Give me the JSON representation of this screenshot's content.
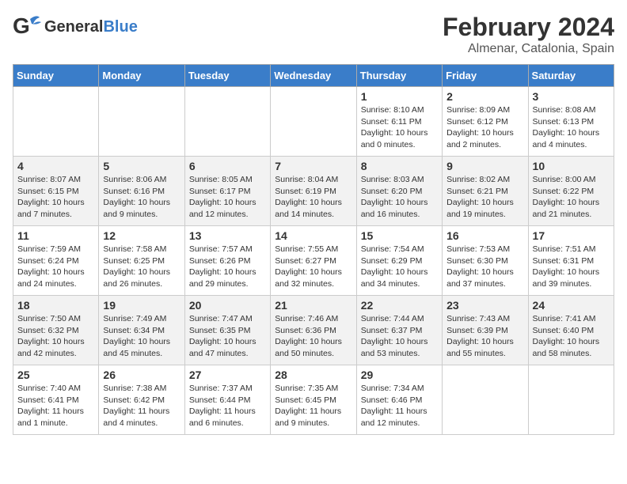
{
  "header": {
    "logo_general": "General",
    "logo_blue": "Blue",
    "title": "February 2024",
    "subtitle": "Almenar, Catalonia, Spain"
  },
  "weekdays": [
    "Sunday",
    "Monday",
    "Tuesday",
    "Wednesday",
    "Thursday",
    "Friday",
    "Saturday"
  ],
  "weeks": [
    [
      {
        "day": "",
        "info": ""
      },
      {
        "day": "",
        "info": ""
      },
      {
        "day": "",
        "info": ""
      },
      {
        "day": "",
        "info": ""
      },
      {
        "day": "1",
        "info": "Sunrise: 8:10 AM\nSunset: 6:11 PM\nDaylight: 10 hours and 0 minutes."
      },
      {
        "day": "2",
        "info": "Sunrise: 8:09 AM\nSunset: 6:12 PM\nDaylight: 10 hours and 2 minutes."
      },
      {
        "day": "3",
        "info": "Sunrise: 8:08 AM\nSunset: 6:13 PM\nDaylight: 10 hours and 4 minutes."
      }
    ],
    [
      {
        "day": "4",
        "info": "Sunrise: 8:07 AM\nSunset: 6:15 PM\nDaylight: 10 hours and 7 minutes."
      },
      {
        "day": "5",
        "info": "Sunrise: 8:06 AM\nSunset: 6:16 PM\nDaylight: 10 hours and 9 minutes."
      },
      {
        "day": "6",
        "info": "Sunrise: 8:05 AM\nSunset: 6:17 PM\nDaylight: 10 hours and 12 minutes."
      },
      {
        "day": "7",
        "info": "Sunrise: 8:04 AM\nSunset: 6:19 PM\nDaylight: 10 hours and 14 minutes."
      },
      {
        "day": "8",
        "info": "Sunrise: 8:03 AM\nSunset: 6:20 PM\nDaylight: 10 hours and 16 minutes."
      },
      {
        "day": "9",
        "info": "Sunrise: 8:02 AM\nSunset: 6:21 PM\nDaylight: 10 hours and 19 minutes."
      },
      {
        "day": "10",
        "info": "Sunrise: 8:00 AM\nSunset: 6:22 PM\nDaylight: 10 hours and 21 minutes."
      }
    ],
    [
      {
        "day": "11",
        "info": "Sunrise: 7:59 AM\nSunset: 6:24 PM\nDaylight: 10 hours and 24 minutes."
      },
      {
        "day": "12",
        "info": "Sunrise: 7:58 AM\nSunset: 6:25 PM\nDaylight: 10 hours and 26 minutes."
      },
      {
        "day": "13",
        "info": "Sunrise: 7:57 AM\nSunset: 6:26 PM\nDaylight: 10 hours and 29 minutes."
      },
      {
        "day": "14",
        "info": "Sunrise: 7:55 AM\nSunset: 6:27 PM\nDaylight: 10 hours and 32 minutes."
      },
      {
        "day": "15",
        "info": "Sunrise: 7:54 AM\nSunset: 6:29 PM\nDaylight: 10 hours and 34 minutes."
      },
      {
        "day": "16",
        "info": "Sunrise: 7:53 AM\nSunset: 6:30 PM\nDaylight: 10 hours and 37 minutes."
      },
      {
        "day": "17",
        "info": "Sunrise: 7:51 AM\nSunset: 6:31 PM\nDaylight: 10 hours and 39 minutes."
      }
    ],
    [
      {
        "day": "18",
        "info": "Sunrise: 7:50 AM\nSunset: 6:32 PM\nDaylight: 10 hours and 42 minutes."
      },
      {
        "day": "19",
        "info": "Sunrise: 7:49 AM\nSunset: 6:34 PM\nDaylight: 10 hours and 45 minutes."
      },
      {
        "day": "20",
        "info": "Sunrise: 7:47 AM\nSunset: 6:35 PM\nDaylight: 10 hours and 47 minutes."
      },
      {
        "day": "21",
        "info": "Sunrise: 7:46 AM\nSunset: 6:36 PM\nDaylight: 10 hours and 50 minutes."
      },
      {
        "day": "22",
        "info": "Sunrise: 7:44 AM\nSunset: 6:37 PM\nDaylight: 10 hours and 53 minutes."
      },
      {
        "day": "23",
        "info": "Sunrise: 7:43 AM\nSunset: 6:39 PM\nDaylight: 10 hours and 55 minutes."
      },
      {
        "day": "24",
        "info": "Sunrise: 7:41 AM\nSunset: 6:40 PM\nDaylight: 10 hours and 58 minutes."
      }
    ],
    [
      {
        "day": "25",
        "info": "Sunrise: 7:40 AM\nSunset: 6:41 PM\nDaylight: 11 hours and 1 minute."
      },
      {
        "day": "26",
        "info": "Sunrise: 7:38 AM\nSunset: 6:42 PM\nDaylight: 11 hours and 4 minutes."
      },
      {
        "day": "27",
        "info": "Sunrise: 7:37 AM\nSunset: 6:44 PM\nDaylight: 11 hours and 6 minutes."
      },
      {
        "day": "28",
        "info": "Sunrise: 7:35 AM\nSunset: 6:45 PM\nDaylight: 11 hours and 9 minutes."
      },
      {
        "day": "29",
        "info": "Sunrise: 7:34 AM\nSunset: 6:46 PM\nDaylight: 11 hours and 12 minutes."
      },
      {
        "day": "",
        "info": ""
      },
      {
        "day": "",
        "info": ""
      }
    ]
  ]
}
